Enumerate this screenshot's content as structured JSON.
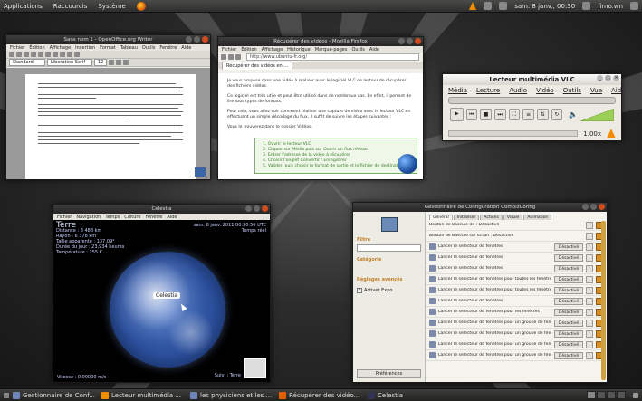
{
  "top_panel": {
    "menus": [
      "Applications",
      "Raccourcis",
      "Système"
    ],
    "clock": "sam. 8 janv., 00:30",
    "user": "fimo.wn"
  },
  "writer": {
    "title": "Sans nom 1 - OpenOffice.org Writer",
    "menus": [
      "Fichier",
      "Édition",
      "Affichage",
      "Insertion",
      "Format",
      "Tableau",
      "Outils",
      "Fenêtre",
      "Aide"
    ],
    "style_value": "Standard",
    "font_value": "Liberation Serif",
    "size_value": "12"
  },
  "firefox": {
    "title": "Récupérer des vidéos - Mozilla Firefox",
    "menus": [
      "Fichier",
      "Édition",
      "Affichage",
      "Historique",
      "Marque-pages",
      "Outils",
      "Aide"
    ],
    "url": "http://www.ubuntu-fr.org/",
    "tab": "Récupérer des vidéos en ...",
    "para1": "Je vous propose dans une vidéo à réaliser avec le logiciel VLC de lecteur de récupérer des fichiers vidéos.",
    "para2": "Ce logiciel est très utile et peut être utilisé dans de nombreux cas. En effet, il permet de lire tous types de formats.",
    "para3": "Pour cela, vous allez voir comment réaliser une capture de vidéo avec le lecteur VLC en effectuant un simple décodage du flux, il suffit de suivre les étapes suivantes :",
    "para4": "Vous le trouverez dans le dossier Vidéos.",
    "steps": [
      "1. Ouvrir le lecteur VLC",
      "2. Cliquer sur Média puis sur Ouvrir un flux réseau",
      "3. Entrer l'adresse de la vidéo à récupérer",
      "4. Choisir l'onglet Convertir / Enregistrer",
      "5. Valider, puis choisir le format de sortie et le fichier de destination"
    ]
  },
  "vlc": {
    "title": "Lecteur multimédia VLC",
    "menus": [
      "Média",
      "Lecture",
      "Audio",
      "Vidéo",
      "Outils",
      "Vue",
      "Aide"
    ],
    "speed": "1.00x",
    "volume_percent": 100,
    "icons": [
      "play-icon",
      "previous-icon",
      "stop-icon",
      "next-icon",
      "fullscreen-icon",
      "playlist-icon",
      "extended-icon",
      "loop-icon",
      "shuffle-icon",
      "volume-icon"
    ]
  },
  "celestia": {
    "title": "Celestia",
    "menus": [
      "Fichier",
      "Navigation",
      "Temps",
      "Culture",
      "Fenêtre",
      "Aide"
    ],
    "body_name": "Terre",
    "distance": "Distance : 8 488 km",
    "radius": "Rayon : 6 378 km",
    "app_mag": "Taille apparente : 137.09°",
    "rotation": "Durée du jour : 23,934 heures",
    "temperature": "Température : 255 K",
    "date": "sam. 8 janv. 2011 00:30:56 UTC",
    "time_rate": "Temps réel",
    "target_label": "Celestia",
    "speed": "Vitesse : 0,00000 m/s",
    "mode": "Suivi : Terre"
  },
  "ccsm": {
    "title": "Gestionnaire de Configuration CompizConfig",
    "filter_label": "Filtre",
    "category_label": "Catégorie",
    "advanced_label": "Réglages avancés",
    "checkbox_label": "Activer Expo",
    "preferences_button": "Préférences",
    "tabs": [
      "Général",
      "Initialiser",
      "Actions",
      "Visuel",
      "Animation"
    ],
    "header_rows": [
      "Bouton de Bascule de : Désactivé",
      "Bouton de Bascule sur Écran : Désactivé"
    ],
    "rows": [
      "Lancer le sélecteur de fenêtres",
      "Lancer le sélecteur de fenêtres",
      "Lancer le sélecteur de fenêtres",
      "Lancer le sélecteur de fenêtres pour toutes les fenêtres",
      "Lancer le sélecteur de fenêtres pour toutes les fenêtres",
      "Lancer le sélecteur de fenêtres",
      "Lancer le sélecteur de fenêtres pour les fenêtres",
      "Lancer le sélecteur de fenêtres pour un groupe de fenêtres",
      "Lancer le sélecteur de fenêtres pour un groupe de fenêtres",
      "Lancer le sélecteur de fenêtres pour un groupe de fenêtres",
      "Lancer le sélecteur de fenêtres pour un groupe de fenêtres"
    ],
    "row_button": "Désactivé"
  },
  "taskbar": {
    "tasks": [
      "Gestionnaire de Conf...",
      "Lecteur multimédia ...",
      "les physiciens et les ...",
      "Récupérer des vidéo...",
      "Celestia"
    ]
  }
}
